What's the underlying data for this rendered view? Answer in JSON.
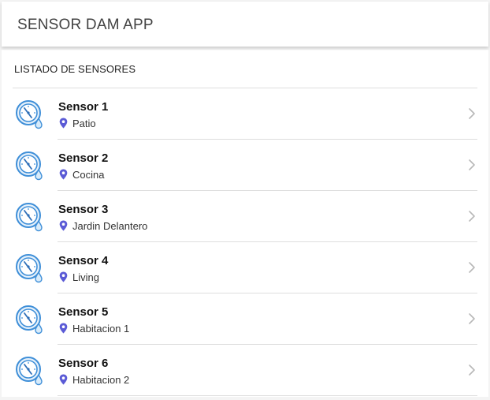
{
  "app": {
    "title": "SENSOR DAM APP"
  },
  "list": {
    "header": "LISTADO DE SENSORES",
    "items": [
      {
        "name": "Sensor 1",
        "location": "Patio"
      },
      {
        "name": "Sensor 2",
        "location": "Cocina"
      },
      {
        "name": "Sensor 3",
        "location": "Jardin Delantero"
      },
      {
        "name": "Sensor 4",
        "location": "Living"
      },
      {
        "name": "Sensor 5",
        "location": "Habitacion 1"
      },
      {
        "name": "Sensor 6",
        "location": "Habitacion 2"
      }
    ]
  },
  "icons": {
    "sensor": "water-gauge-icon",
    "location": "location-pin-icon",
    "navigate": "chevron-right-icon"
  },
  "colors": {
    "sensor_icon": "#3f8fd8",
    "pin": "#5b5bd6",
    "chevron": "#b8b8b8"
  }
}
